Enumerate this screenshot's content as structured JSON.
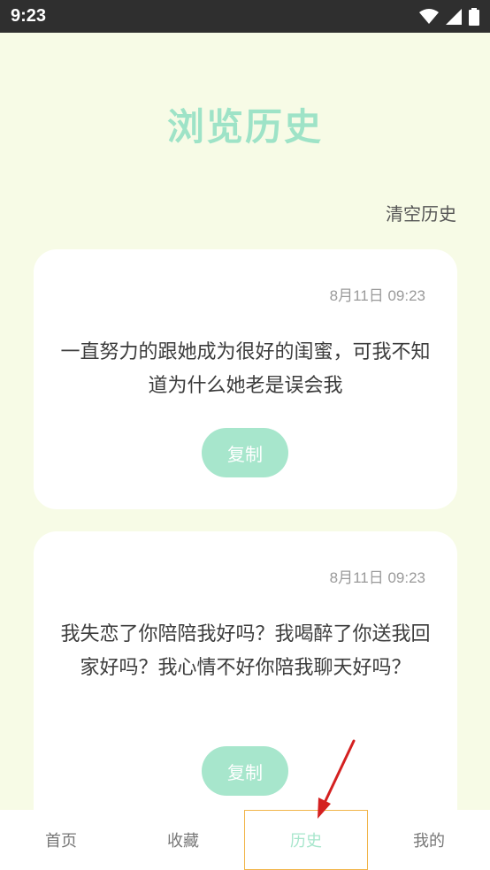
{
  "status_bar": {
    "time": "9:23"
  },
  "page": {
    "title": "浏览历史",
    "clear_label": "清空历史"
  },
  "history": [
    {
      "time": "8月11日 09:23",
      "text": "一直努力的跟她成为很好的闺蜜，可我不知道为什么她老是误会我",
      "copy_label": "复制"
    },
    {
      "time": "8月11日 09:23",
      "text": "我失恋了你陪陪我好吗？我喝醉了你送我回家好吗？我心情不好你陪我聊天好吗？",
      "copy_label": "复制"
    }
  ],
  "tabs": [
    {
      "label": "首页"
    },
    {
      "label": "收藏"
    },
    {
      "label": "历史",
      "active": true
    },
    {
      "label": "我的"
    }
  ],
  "colors": {
    "background": "#f7fbe6",
    "accent": "#a7e6cc",
    "title": "#9ee3c7",
    "annotation_arrow": "#d42020",
    "active_tab_border": "#f1b54a"
  }
}
